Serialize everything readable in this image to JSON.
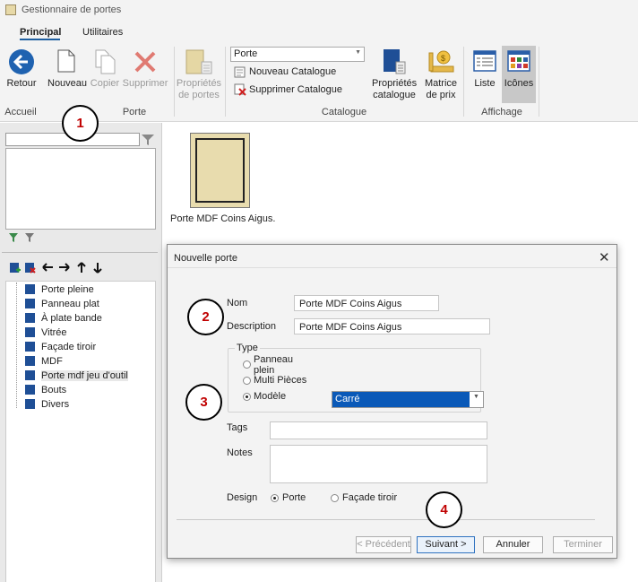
{
  "app": {
    "title": "Gestionnaire de portes"
  },
  "ribbon": {
    "tabs": [
      "Principal",
      "Utilitaires"
    ],
    "retour": "Retour",
    "nouveau": "Nouveau",
    "copier": "Copier",
    "supprimer": "Supprimer",
    "proprietes_portes_l1": "Propriétés",
    "proprietes_portes_l2": "de portes",
    "catalogue_combo": "Porte",
    "nouveau_catalogue": "Nouveau Catalogue",
    "supprimer_catalogue": "Supprimer Catalogue",
    "proprietes_catalogue_l1": "Propriétés",
    "proprietes_catalogue_l2": "catalogue",
    "matrice_l1": "Matrice",
    "matrice_l2": "de prix",
    "liste": "Liste",
    "icones": "Icônes",
    "groups": {
      "accueil": "Accueil",
      "porte": "Porte",
      "catalogue": "Catalogue",
      "affichage": "Affichage"
    }
  },
  "tree": {
    "items": [
      "Porte pleine",
      "Panneau plat",
      "À plate bande",
      "Vitrée",
      "Façade tiroir",
      "MDF",
      "Porte mdf jeu d'outil",
      "Bouts",
      "Divers"
    ]
  },
  "main": {
    "thumb_label": "Porte MDF Coins Aigus."
  },
  "dialog": {
    "title": "Nouvelle porte",
    "nom_label": "Nom",
    "nom_value": "Porte MDF Coins Aigus",
    "description_label": "Description",
    "description_value": "Porte MDF Coins Aigus",
    "type_label": "Type",
    "type_options": [
      "Panneau plein",
      "Multi Pièces",
      "Modèle"
    ],
    "model_value": "Carré",
    "tags_label": "Tags",
    "notes_label": "Notes",
    "design_label": "Design",
    "design_options": [
      "Porte",
      "Façade tiroir"
    ],
    "buttons": {
      "prev": "< Précédent",
      "next": "Suivant >",
      "cancel": "Annuler",
      "finish": "Terminer"
    }
  },
  "callouts": [
    "1",
    "2",
    "3",
    "4"
  ],
  "colors": {
    "accent": "#1f5fa0",
    "callout_text": "#c00000",
    "selection": "#0a59b8",
    "door_fill": "#e8dcae"
  }
}
